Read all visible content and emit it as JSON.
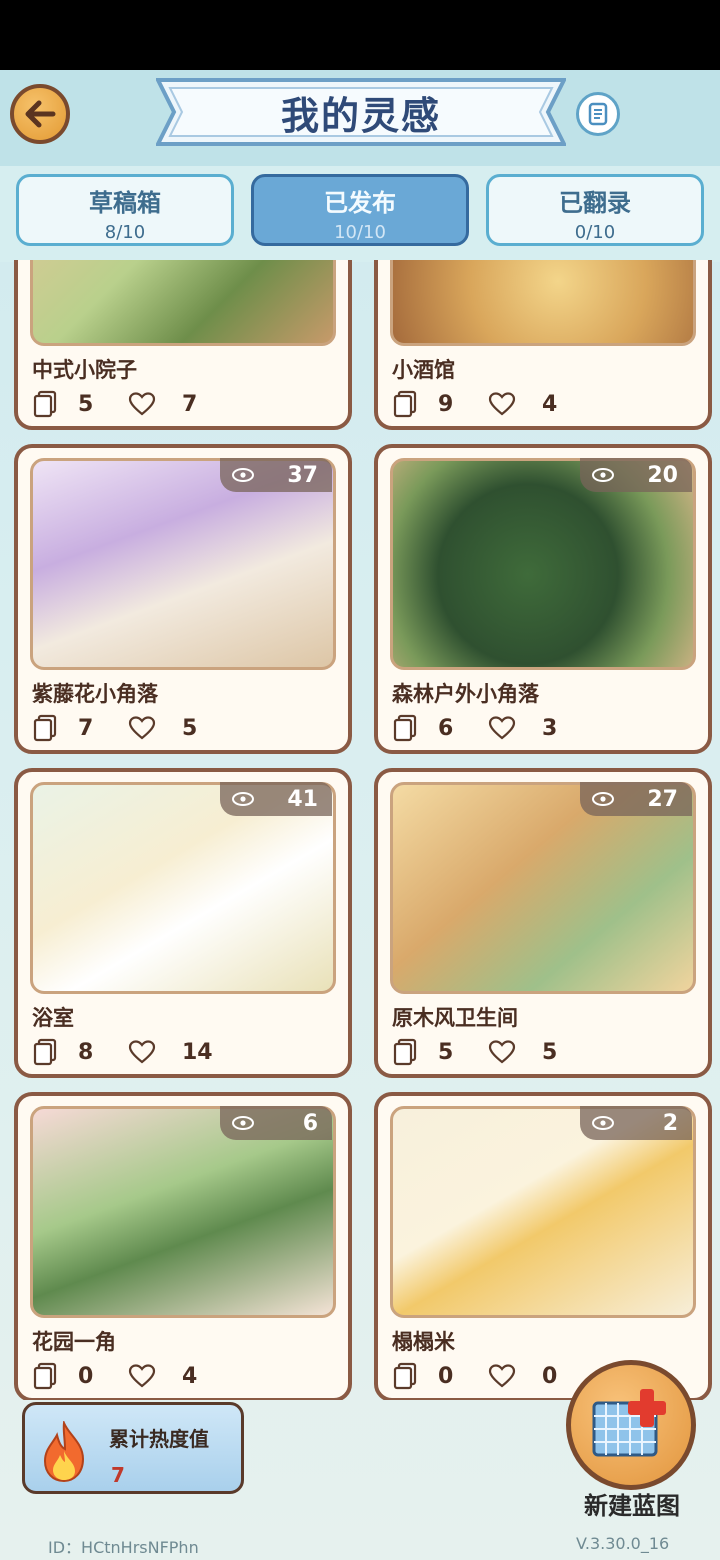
{
  "header": {
    "title": "我的灵感",
    "back_icon": "arrow-left-icon",
    "scroll_icon": "scroll-icon"
  },
  "tabs": [
    {
      "label": "草稿箱",
      "count": "8/10",
      "active": false
    },
    {
      "label": "已发布",
      "count": "10/10",
      "active": true
    },
    {
      "label": "已翻录",
      "count": "0/10",
      "active": false
    }
  ],
  "cards": [
    {
      "name": "中式小院子",
      "views": "",
      "copies": "5",
      "likes": "7"
    },
    {
      "name": "小酒馆",
      "views": "",
      "copies": "9",
      "likes": "4"
    },
    {
      "name": "紫藤花小角落",
      "views": "37",
      "copies": "7",
      "likes": "5"
    },
    {
      "name": "森林户外小角落",
      "views": "20",
      "copies": "6",
      "likes": "3"
    },
    {
      "name": "浴室",
      "views": "41",
      "copies": "8",
      "likes": "14"
    },
    {
      "name": "原木风卫生间",
      "views": "27",
      "copies": "5",
      "likes": "5"
    },
    {
      "name": "花园一角",
      "views": "6",
      "copies": "0",
      "likes": "4"
    },
    {
      "name": "榻榻米",
      "views": "2",
      "copies": "0",
      "likes": "0"
    }
  ],
  "heat": {
    "label": "累计热度值",
    "value": "7",
    "icon": "flame-icon"
  },
  "new_blueprint": {
    "label": "新建蓝图",
    "icon": "blueprint-add-icon"
  },
  "footer": {
    "id": "ID：HCtnHrsNFPhn",
    "version": "V.3.30.0_16"
  },
  "colors": {
    "accent": "#6aa8d6",
    "border_brown": "#8a5a44",
    "title_blue": "#2f4a78",
    "orange": "#e39a33"
  }
}
